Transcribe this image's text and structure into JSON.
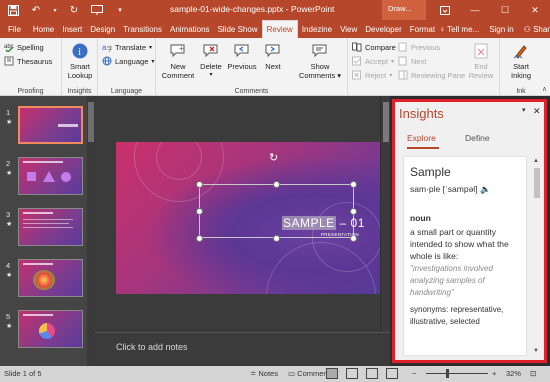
{
  "titlebar": {
    "title": "sample-01-wide-changes.pptx - PowerPoint",
    "contextual_label": "Draw...",
    "qat": {
      "save_icon": "save-icon",
      "undo_icon": "undo-icon",
      "redo_icon": "redo-icon",
      "start_icon": "start-from-beginning-icon",
      "customize_icon": "customize-qat-icon"
    },
    "window_controls": {
      "ribbon_options": "ribbon-display-options-icon",
      "minimize": "—",
      "maximize": "☐",
      "close": "✕"
    }
  },
  "tabs": {
    "items": [
      {
        "label": "File"
      },
      {
        "label": "Home"
      },
      {
        "label": "Insert"
      },
      {
        "label": "Design"
      },
      {
        "label": "Transitions"
      },
      {
        "label": "Animations"
      },
      {
        "label": "Slide Show"
      },
      {
        "label": "Review"
      },
      {
        "label": "Indezine"
      },
      {
        "label": "View"
      },
      {
        "label": "Developer"
      },
      {
        "label": "Format"
      }
    ],
    "active": "Review",
    "tell_me": "Tell me...",
    "sign_in": "Sign in",
    "share": "Share"
  },
  "ribbon": {
    "proofing": {
      "label": "Proofing",
      "spelling": "Spelling",
      "thesaurus": "Thesaurus"
    },
    "insights": {
      "label": "Insights",
      "smart_lookup_1": "Smart",
      "smart_lookup_2": "Lookup"
    },
    "language": {
      "label": "Language",
      "translate": "Translate",
      "language": "Language"
    },
    "comments": {
      "label": "Comments",
      "new_1": "New",
      "new_2": "Comment",
      "delete": "Delete",
      "previous": "Previous",
      "next": "Next",
      "show_1": "Show",
      "show_2": "Comments"
    },
    "compare": {
      "compare": "Compare",
      "accept": "Accept",
      "reject": "Reject",
      "previous": "Previous",
      "next": "Next",
      "reviewing_pane": "Reviewing Pane",
      "end_1": "End",
      "end_2": "Review"
    },
    "ink": {
      "label": "Ink",
      "start_1": "Start",
      "start_2": "Inking"
    }
  },
  "thumbnails": [
    {
      "num": "1",
      "star": "★"
    },
    {
      "num": "2",
      "star": "★"
    },
    {
      "num": "3",
      "star": "★"
    },
    {
      "num": "4",
      "star": "★"
    },
    {
      "num": "5",
      "star": "★"
    }
  ],
  "slide": {
    "title_highlight": "SAMPLE",
    "title_rest": " – 01",
    "subtitle": "PRESENTATION"
  },
  "notes": {
    "placeholder": "Click to add notes"
  },
  "insights_pane": {
    "title": "Insights",
    "tabs": {
      "explore": "Explore",
      "define": "Define"
    },
    "word": "Sample",
    "pronunciation": "sam·ple [ˈsampəl]",
    "part_of_speech": "noun",
    "definition": "a small part or quantity intended to show what the whole is like:",
    "example": "\"investigations involved analyzing samples of handwriting\"",
    "synonyms": "synonyms: representative, illustrative, selected"
  },
  "status": {
    "slide_counter": "Slide 1 of 5",
    "notes": "Notes",
    "comments": "Comments",
    "zoom": "32%"
  }
}
